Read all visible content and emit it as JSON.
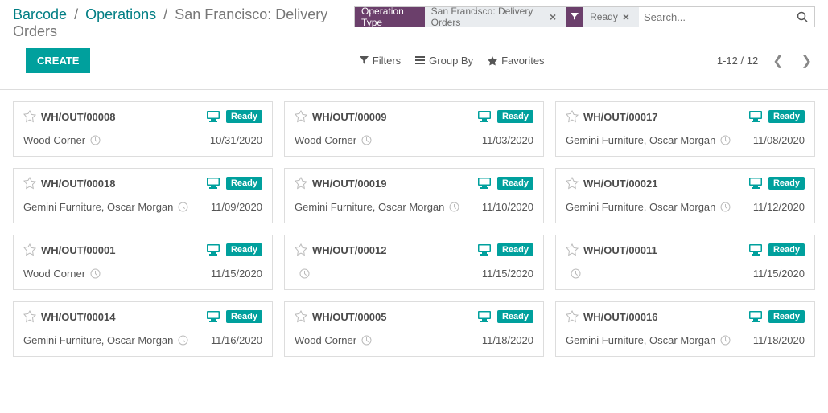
{
  "breadcrumbs": {
    "a": "Barcode",
    "b": "Operations",
    "c": "San Francisco: Delivery Orders"
  },
  "create_label": "CREATE",
  "searchbar": {
    "tag1": {
      "label": "Operation Type",
      "value": "San Francisco: Delivery Orders"
    },
    "tag2": {
      "value": "Ready"
    },
    "placeholder": "Search..."
  },
  "toolbar": {
    "filters": "Filters",
    "groupby": "Group By",
    "favorites": "Favorites",
    "pager": "1-12 / 12"
  },
  "cards": [
    {
      "ref": "WH/OUT/00008",
      "status": "Ready",
      "partner": "Wood Corner",
      "date": "10/31/2020"
    },
    {
      "ref": "WH/OUT/00009",
      "status": "Ready",
      "partner": "Wood Corner",
      "date": "11/03/2020"
    },
    {
      "ref": "WH/OUT/00017",
      "status": "Ready",
      "partner": "Gemini Furniture, Oscar Morgan",
      "date": "11/08/2020"
    },
    {
      "ref": "WH/OUT/00018",
      "status": "Ready",
      "partner": "Gemini Furniture, Oscar Morgan",
      "date": "11/09/2020"
    },
    {
      "ref": "WH/OUT/00019",
      "status": "Ready",
      "partner": "Gemini Furniture, Oscar Morgan",
      "date": "11/10/2020"
    },
    {
      "ref": "WH/OUT/00021",
      "status": "Ready",
      "partner": "Gemini Furniture, Oscar Morgan",
      "date": "11/12/2020"
    },
    {
      "ref": "WH/OUT/00001",
      "status": "Ready",
      "partner": "Wood Corner",
      "date": "11/15/2020"
    },
    {
      "ref": "WH/OUT/00012",
      "status": "Ready",
      "partner": "",
      "date": "11/15/2020"
    },
    {
      "ref": "WH/OUT/00011",
      "status": "Ready",
      "partner": "",
      "date": "11/15/2020"
    },
    {
      "ref": "WH/OUT/00014",
      "status": "Ready",
      "partner": "Gemini Furniture, Oscar Morgan",
      "date": "11/16/2020"
    },
    {
      "ref": "WH/OUT/00005",
      "status": "Ready",
      "partner": "Wood Corner",
      "date": "11/18/2020"
    },
    {
      "ref": "WH/OUT/00016",
      "status": "Ready",
      "partner": "Gemini Furniture, Oscar Morgan",
      "date": "11/18/2020"
    }
  ]
}
